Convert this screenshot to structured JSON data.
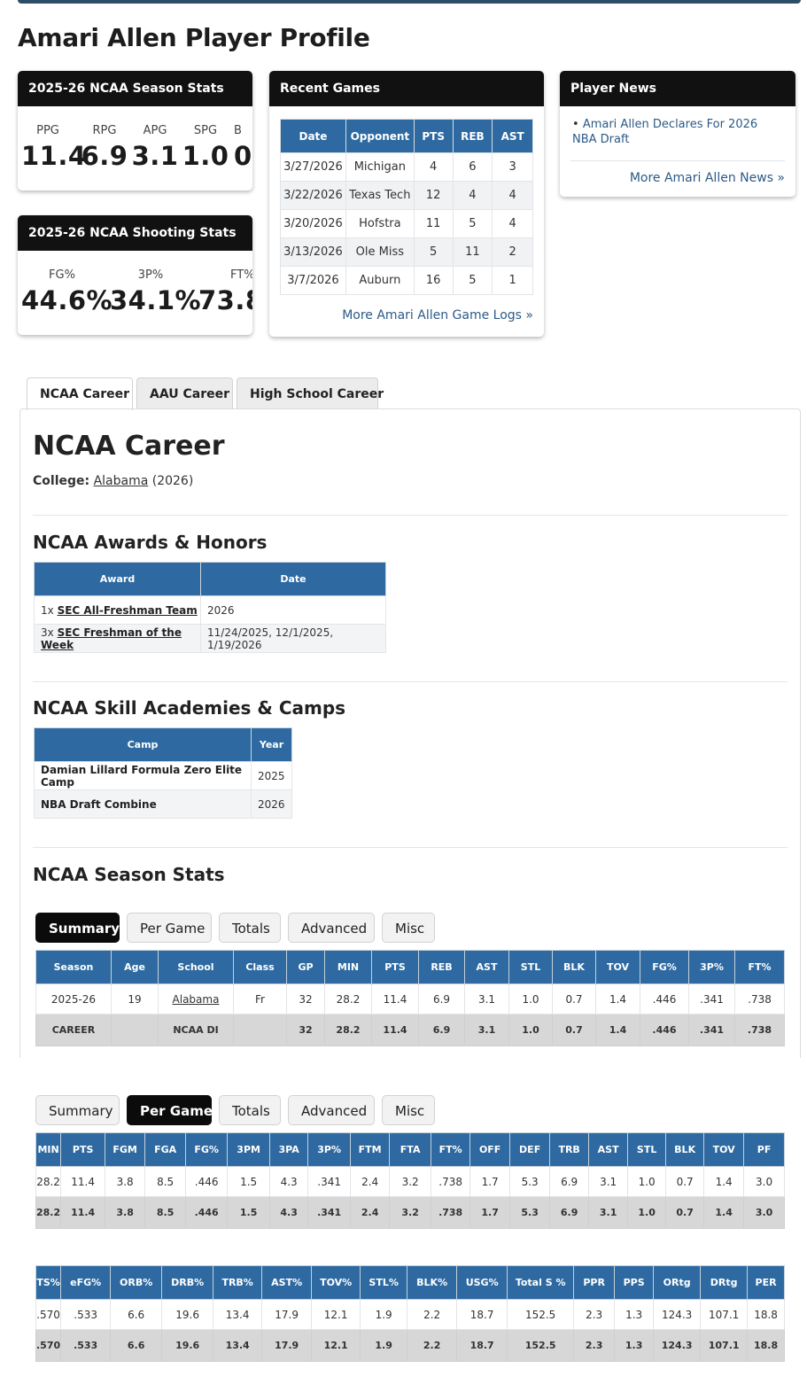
{
  "page_title": "Amari Allen Player Profile",
  "season_stats": {
    "title": "2025-26 NCAA Season Stats",
    "items": [
      {
        "label": "PPG",
        "value": "11.4"
      },
      {
        "label": "RPG",
        "value": "6.9"
      },
      {
        "label": "APG",
        "value": "3.1"
      },
      {
        "label": "SPG",
        "value": "1.0"
      },
      {
        "label": "B",
        "value": "0"
      }
    ]
  },
  "shooting_stats": {
    "title": "2025-26 NCAA Shooting Stats",
    "items": [
      {
        "label": "FG%",
        "value": "44.6%"
      },
      {
        "label": "3P%",
        "value": "34.1%"
      },
      {
        "label": "FT%",
        "value": "73.8"
      }
    ]
  },
  "recent_games": {
    "title": "Recent Games",
    "columns": [
      "Date",
      "Opponent",
      "PTS",
      "REB",
      "AST"
    ],
    "rows": [
      [
        "3/27/2026",
        "Michigan",
        "4",
        "6",
        "3"
      ],
      [
        "3/22/2026",
        "Texas Tech",
        "12",
        "4",
        "4"
      ],
      [
        "3/20/2026",
        "Hofstra",
        "11",
        "5",
        "4"
      ],
      [
        "3/13/2026",
        "Ole Miss",
        "5",
        "11",
        "2"
      ],
      [
        "3/7/2026",
        "Auburn",
        "16",
        "5",
        "1"
      ]
    ],
    "more_link": "More Amari Allen Game Logs »"
  },
  "player_news": {
    "title": "Player News",
    "items": [
      "Amari Allen Declares For 2026 NBA Draft"
    ],
    "more_link": "More Amari Allen News »"
  },
  "career_tabs": [
    "NCAA Career",
    "AAU Career",
    "High School Career"
  ],
  "ncaa_career": {
    "heading": "NCAA Career",
    "college_label": "College:",
    "college_name": "Alabama",
    "college_year": "(2026)"
  },
  "awards": {
    "heading": "NCAA Awards & Honors",
    "columns": [
      "Award",
      "Date"
    ],
    "rows": [
      {
        "count": "1x",
        "name": "SEC All-Freshman Team",
        "date": "2026"
      },
      {
        "count": "3x",
        "name": "SEC Freshman of the Week",
        "date": "11/24/2025, 12/1/2025, 1/19/2026"
      }
    ]
  },
  "camps": {
    "heading": "NCAA Skill Academies & Camps",
    "columns": [
      "Camp",
      "Year"
    ],
    "rows": [
      [
        "Damian Lillard Formula Zero Elite Camp",
        "2025"
      ],
      [
        "NBA Draft Combine",
        "2026"
      ]
    ]
  },
  "season_stats_section": {
    "heading": "NCAA Season Stats",
    "tabs": [
      "Summary",
      "Per Game",
      "Totals",
      "Advanced",
      "Misc"
    ]
  },
  "summary_table": {
    "columns": [
      "Season",
      "Age",
      "School",
      "Class",
      "GP",
      "MIN",
      "PTS",
      "REB",
      "AST",
      "STL",
      "BLK",
      "TOV",
      "FG%",
      "3P%",
      "FT%"
    ],
    "rows": [
      [
        "2025-26",
        "19",
        "Alabama",
        "Fr",
        "32",
        "28.2",
        "11.4",
        "6.9",
        "3.1",
        "1.0",
        "0.7",
        "1.4",
        ".446",
        ".341",
        ".738"
      ]
    ],
    "career": [
      "CAREER",
      "",
      "NCAA DI",
      "",
      "32",
      "28.2",
      "11.4",
      "6.9",
      "3.1",
      "1.0",
      "0.7",
      "1.4",
      ".446",
      ".341",
      ".738"
    ]
  },
  "per_game_table": {
    "columns": [
      "MIN",
      "PTS",
      "FGM",
      "FGA",
      "FG%",
      "3PM",
      "3PA",
      "3P%",
      "FTM",
      "FTA",
      "FT%",
      "OFF",
      "DEF",
      "TRB",
      "AST",
      "STL",
      "BLK",
      "TOV",
      "PF"
    ],
    "rows": [
      [
        "28.2",
        "11.4",
        "3.8",
        "8.5",
        ".446",
        "1.5",
        "4.3",
        ".341",
        "2.4",
        "3.2",
        ".738",
        "1.7",
        "5.3",
        "6.9",
        "3.1",
        "1.0",
        "0.7",
        "1.4",
        "3.0"
      ]
    ],
    "career": [
      "28.2",
      "11.4",
      "3.8",
      "8.5",
      ".446",
      "1.5",
      "4.3",
      ".341",
      "2.4",
      "3.2",
      ".738",
      "1.7",
      "5.3",
      "6.9",
      "3.1",
      "1.0",
      "0.7",
      "1.4",
      "3.0"
    ]
  },
  "advanced_table": {
    "columns": [
      "TS%",
      "eFG%",
      "ORB%",
      "DRB%",
      "TRB%",
      "AST%",
      "TOV%",
      "STL%",
      "BLK%",
      "USG%",
      "Total S %",
      "PPR",
      "PPS",
      "ORtg",
      "DRtg",
      "PER"
    ],
    "rows": [
      [
        ".570",
        ".533",
        "6.6",
        "19.6",
        "13.4",
        "17.9",
        "12.1",
        "1.9",
        "2.2",
        "18.7",
        "152.5",
        "2.3",
        "1.3",
        "124.3",
        "107.1",
        "18.8"
      ]
    ],
    "career": [
      ".570",
      ".533",
      "6.6",
      "19.6",
      "13.4",
      "17.9",
      "12.1",
      "1.9",
      "2.2",
      "18.7",
      "152.5",
      "2.3",
      "1.3",
      "124.3",
      "107.1",
      "18.8"
    ]
  }
}
